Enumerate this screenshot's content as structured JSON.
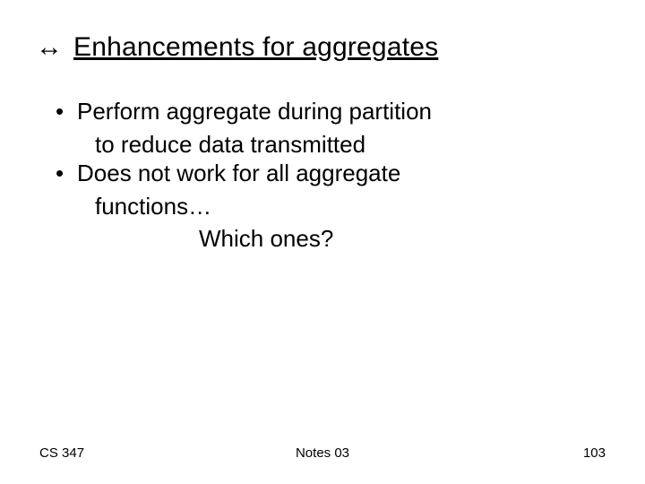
{
  "title": {
    "icon": "↔",
    "text": "Enhancements for aggregates"
  },
  "bullets": [
    {
      "line1": "Perform aggregate during partition",
      "line2": "to reduce data transmitted"
    },
    {
      "line1": "Does not work for all aggregate",
      "line2": "functions…"
    }
  ],
  "question": "Which ones?",
  "footer": {
    "left": "CS 347",
    "center": "Notes 03",
    "right": "103"
  }
}
